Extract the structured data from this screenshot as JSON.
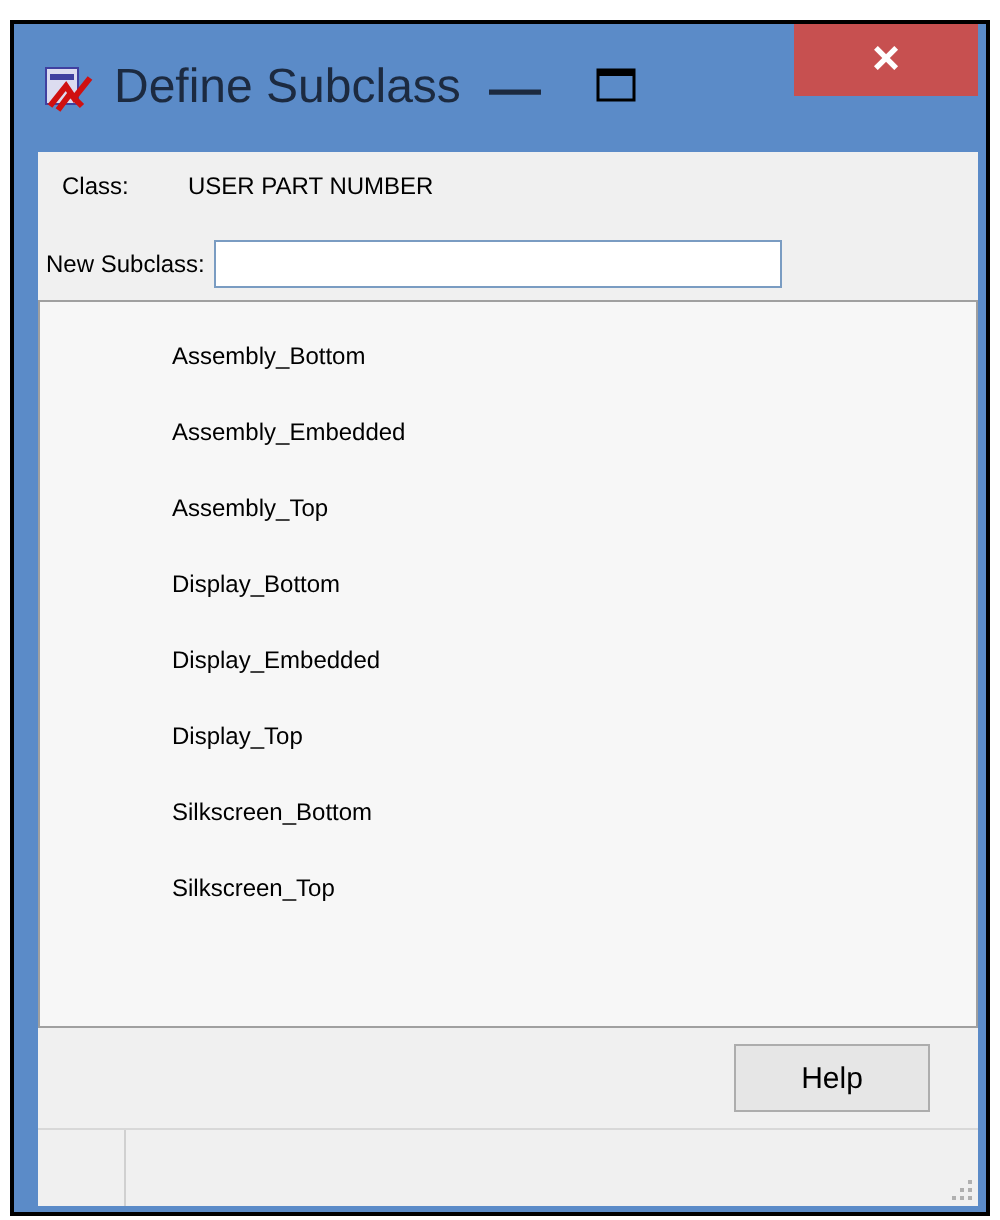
{
  "window": {
    "title": "Define Subclass",
    "controls": [
      "—",
      "×"
    ]
  },
  "class_row": {
    "label": "Class:",
    "value": "USER PART NUMBER"
  },
  "new_subclass": {
    "label": "New Subclass:"
  },
  "subclasses": [
    "Assembly_Bottom",
    "Assembly_Embedded",
    "Assembly_Top",
    "Display_Bottom",
    "Display_Embedded",
    "Display_Top",
    "Silkscreen_Bottom",
    "Silkscreen_Top"
  ],
  "buttons": [
    "Help"
  ]
}
